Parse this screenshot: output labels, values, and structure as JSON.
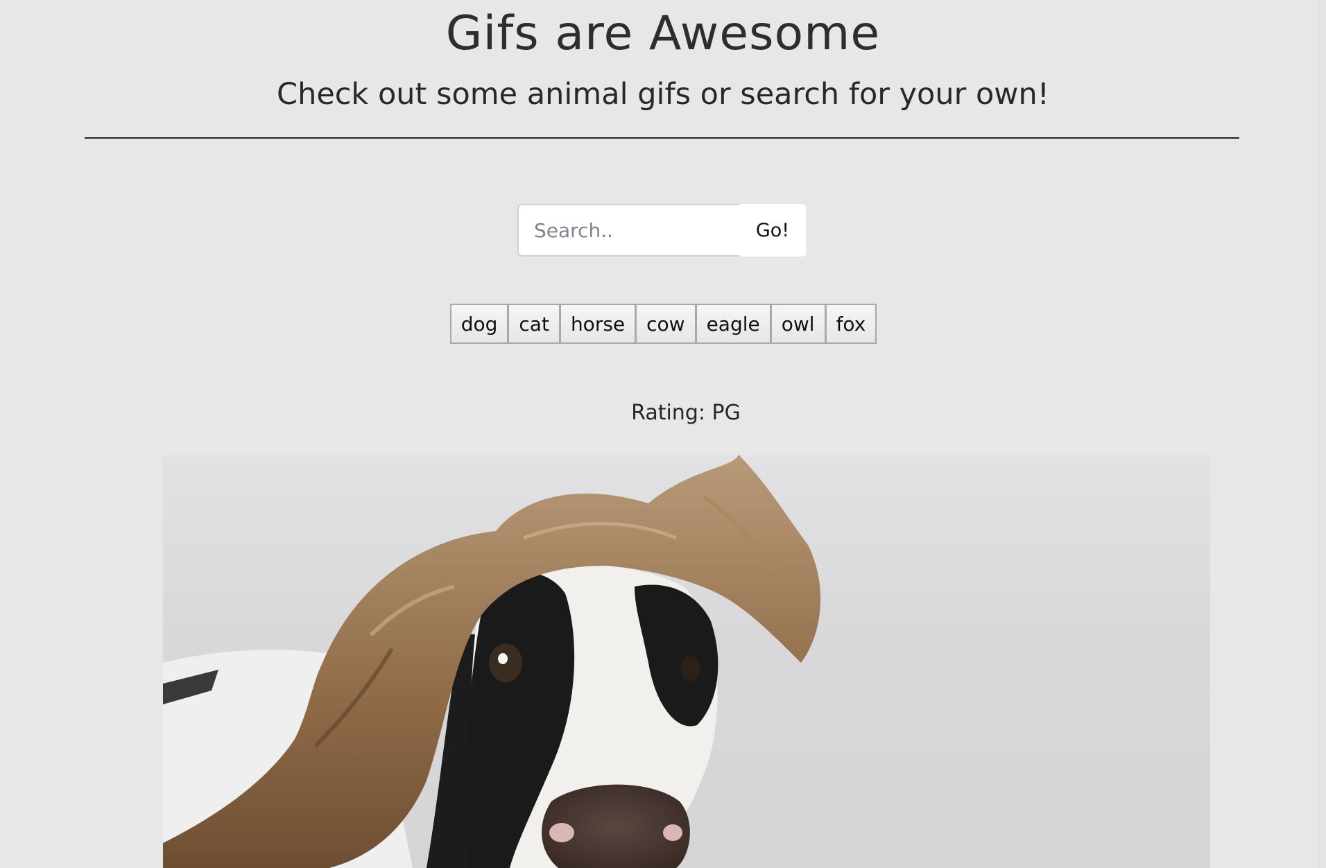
{
  "header": {
    "title": "Gifs are Awesome",
    "subtitle": "Check out some animal gifs or search for your own!"
  },
  "search": {
    "placeholder": "Search..",
    "value": "",
    "button_label": "Go!"
  },
  "animal_buttons": [
    "dog",
    "cat",
    "horse",
    "cow",
    "eagle",
    "owl",
    "fox"
  ],
  "results": [
    {
      "rating_text": "Rating: PG",
      "image_subject": "cow-with-flowing-hair"
    }
  ]
}
